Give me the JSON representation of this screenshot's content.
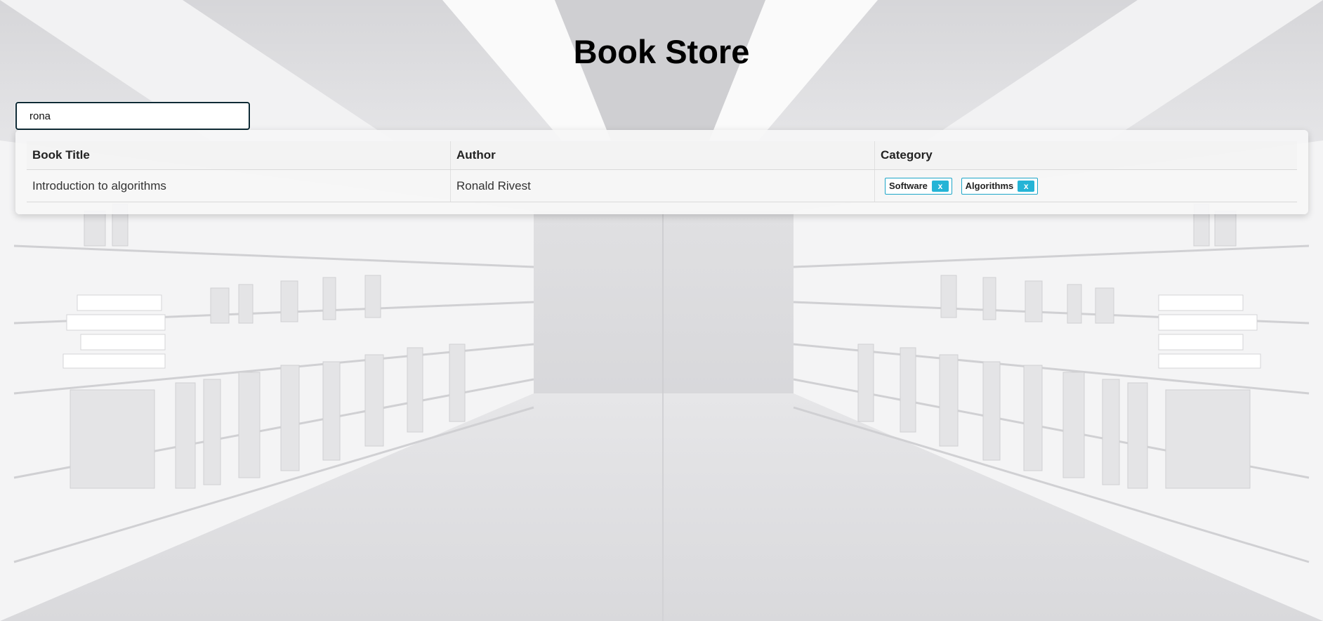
{
  "page": {
    "title": "Book Store"
  },
  "search": {
    "value": "rona",
    "placeholder": ""
  },
  "table": {
    "headers": {
      "title": "Book Title",
      "author": "Author",
      "category": "Category"
    },
    "rows": [
      {
        "title": "Introduction to algorithms",
        "author": "Ronald Rivest",
        "categories": [
          {
            "label": "Software",
            "remove": "x"
          },
          {
            "label": "Algorithms",
            "remove": "x"
          }
        ]
      }
    ]
  },
  "colors": {
    "tag_accent": "#24b4d6",
    "search_border": "#0f2b36"
  }
}
